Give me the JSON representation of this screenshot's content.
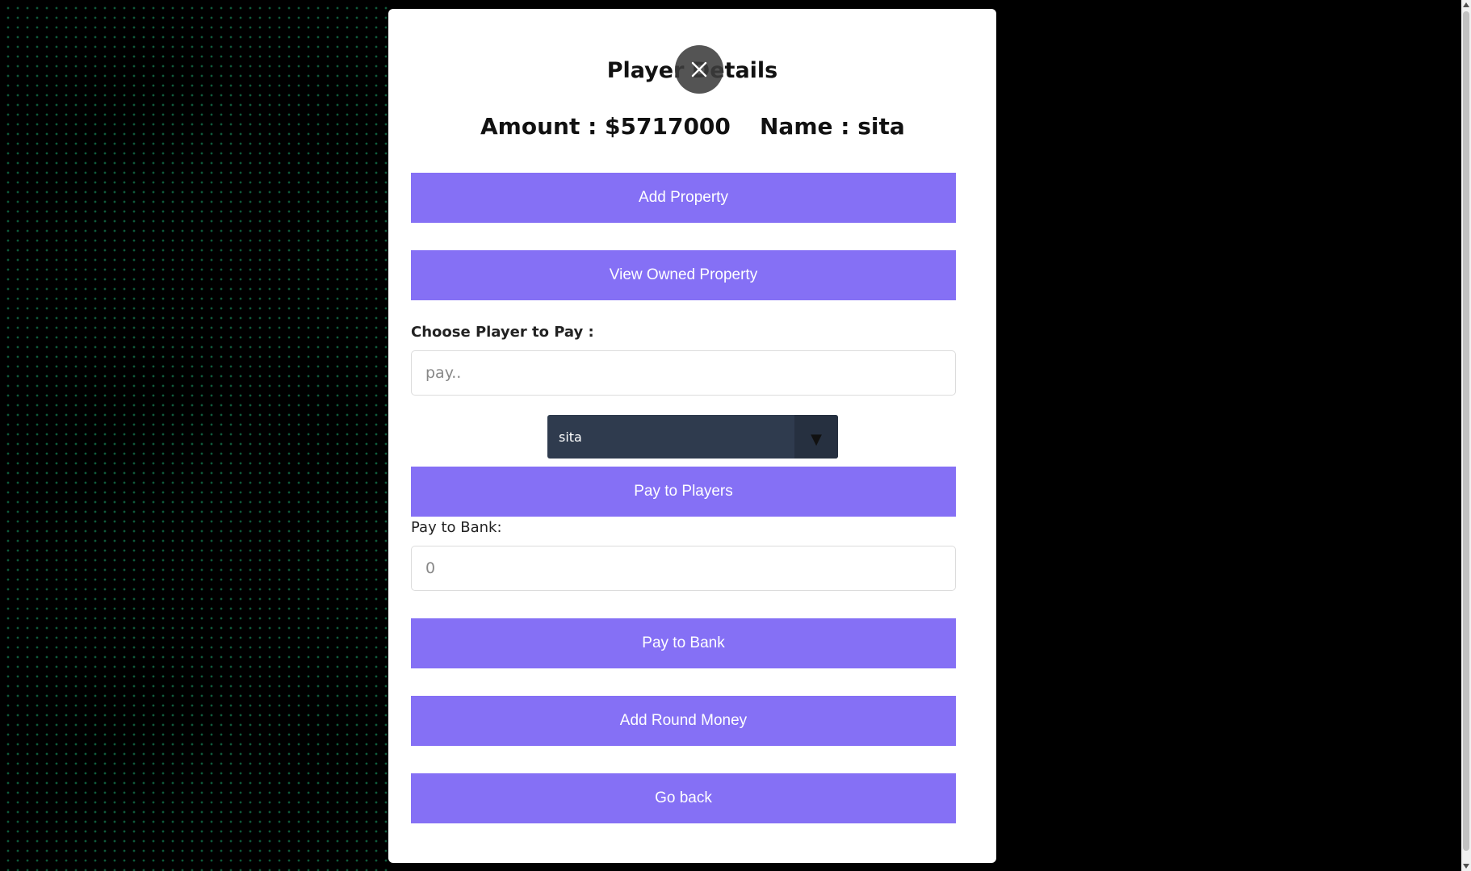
{
  "modal": {
    "title": "Player Details",
    "amount_text": "Amount : $5717000",
    "name_text": "Name : sita"
  },
  "buttons": {
    "add_property": "Add Property",
    "view_owned_property": "View Owned Property",
    "pay_to_players": "Pay to Players",
    "pay_to_bank": "Pay to Bank",
    "add_round_money": "Add Round Money",
    "go_back": "Go back"
  },
  "pay_player": {
    "label": "Choose Player to Pay :",
    "placeholder": "pay..",
    "selected_player": "sita",
    "dropdown_icon": "▼"
  },
  "pay_bank": {
    "label": "Pay to Bank:",
    "value": "0"
  },
  "icons": {
    "close": "close-icon"
  },
  "colors": {
    "button_bg": "#8570f5",
    "select_bg": "#2f3b4e"
  }
}
